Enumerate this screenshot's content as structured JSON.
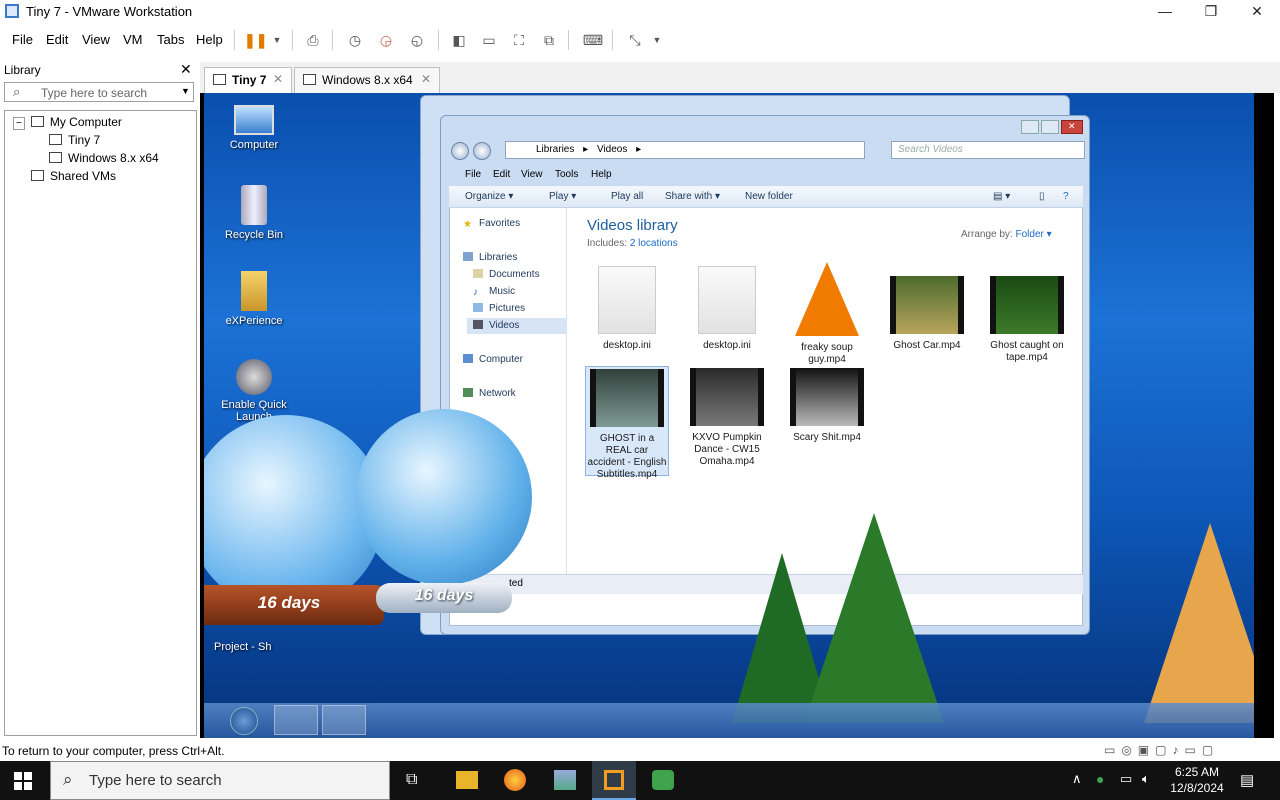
{
  "window": {
    "title": "Tiny 7 - VMware Workstation",
    "min": "—",
    "max": "❐",
    "close": "✕"
  },
  "menubar": [
    "File",
    "Edit",
    "View",
    "VM",
    "Tabs",
    "Help"
  ],
  "library": {
    "title": "Library",
    "close": "✕",
    "search_placeholder": "Type here to search",
    "tree": {
      "my_computer": "My Computer",
      "vms": [
        "Tiny 7",
        "Windows 8.x x64"
      ],
      "shared": "Shared VMs"
    }
  },
  "tabs": [
    {
      "label": "Tiny 7",
      "active": true
    },
    {
      "label": "Windows 8.x x64",
      "active": false
    }
  ],
  "guest": {
    "desktop_icons": [
      "Computer",
      "Recycle Bin",
      "eXPerience",
      "Enable Quick Launch",
      "Project - Sh"
    ],
    "explorer": {
      "breadcrumb": [
        "Libraries",
        "Videos"
      ],
      "search_placeholder": "Search Videos",
      "menu": [
        "File",
        "Edit",
        "View",
        "Tools",
        "Help"
      ],
      "commands": [
        "Organize ▾",
        "Play ▾",
        "Play all",
        "Share with ▾",
        "New folder"
      ],
      "nav": {
        "favorites": "Favorites",
        "libraries": "Libraries",
        "library_items": [
          "Documents",
          "Music",
          "Pictures",
          "Videos"
        ],
        "computer": "Computer",
        "network": "Network"
      },
      "library_title": "Videos library",
      "includes_label": "Includes:",
      "includes_link": "2 locations",
      "arrange_label": "Arrange by:",
      "arrange_value": "Folder ▾",
      "files_row1": [
        "desktop.ini",
        "desktop.ini",
        "freaky soup guy.mp4",
        "Ghost Car.mp4",
        "Ghost caught on tape.mp4"
      ],
      "files_row2": [
        "GHOST in a REAL car accident - English Subtitles.mp4",
        "KXVO Pumpkin Dance - CW15 Omaha.mp4",
        "Scary Shit.mp4"
      ],
      "status": "ted"
    },
    "gadget_days": [
      "16 days",
      "16 days"
    ]
  },
  "statusbar": {
    "hint": "To return to your computer, press Ctrl+Alt."
  },
  "taskbar": {
    "search_placeholder": "Type here to search",
    "time": "6:25 AM",
    "date": "12/8/2024"
  },
  "colors": {
    "accent": "#3a78c8",
    "guest_bg": "#1c72d6",
    "link": "#1b6cc5"
  }
}
